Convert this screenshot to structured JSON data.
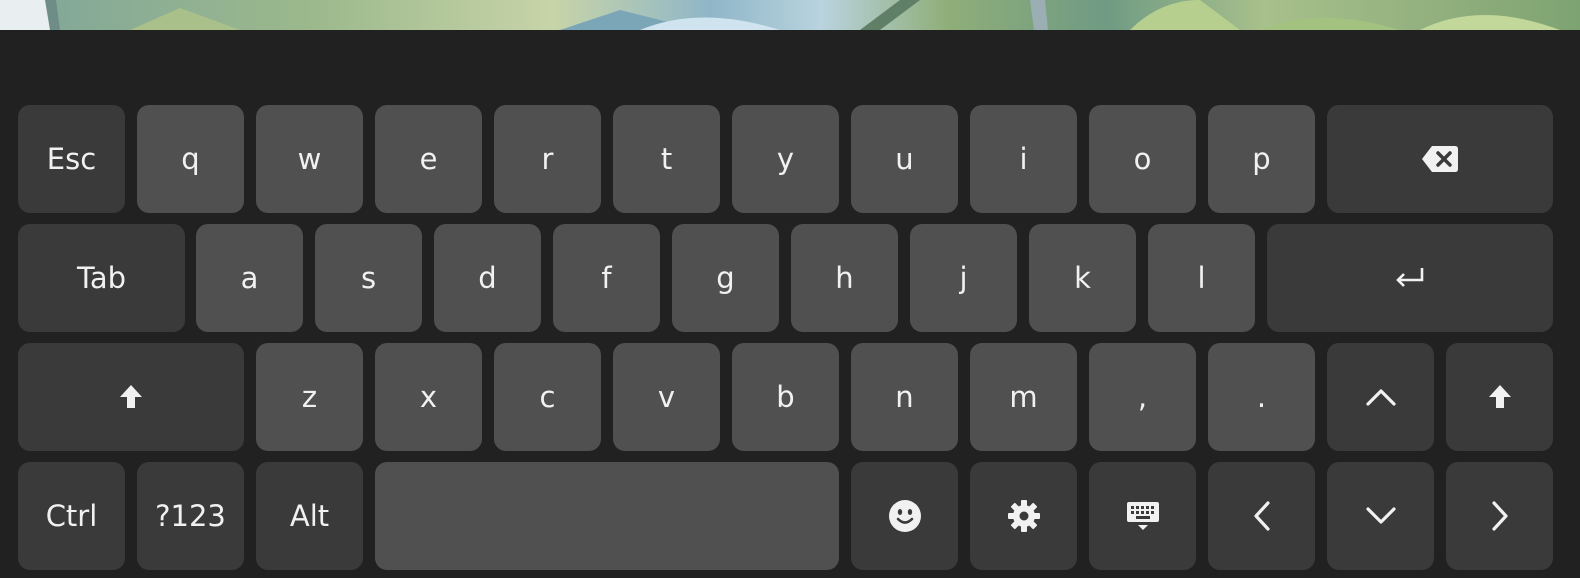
{
  "keyboard": {
    "row1": {
      "esc": "Esc",
      "letters": [
        "q",
        "w",
        "e",
        "r",
        "t",
        "y",
        "u",
        "i",
        "o",
        "p"
      ],
      "backspace_icon": "backspace-icon"
    },
    "row2": {
      "tab": "Tab",
      "letters": [
        "a",
        "s",
        "d",
        "f",
        "g",
        "h",
        "j",
        "k",
        "l"
      ],
      "enter_icon": "enter-icon"
    },
    "row3": {
      "shift_icon": "shift-icon",
      "letters": [
        "z",
        "x",
        "c",
        "v",
        "b",
        "n",
        "m",
        ",",
        "."
      ],
      "up_icon": "chevron-up-icon",
      "shift_right_icon": "shift-icon"
    },
    "row4": {
      "ctrl": "Ctrl",
      "symbols": "?123",
      "alt": "Alt",
      "emoji_icon": "emoji-icon",
      "settings_icon": "gear-icon",
      "hide_keyboard_icon": "keyboard-hide-icon",
      "left_icon": "chevron-left-icon",
      "down_icon": "chevron-down-icon",
      "right_icon": "chevron-right-icon"
    },
    "colors": {
      "background": "#212121",
      "letter_key": "#505050",
      "function_key": "#3a3a3a",
      "text": "#f1f1f1"
    }
  }
}
